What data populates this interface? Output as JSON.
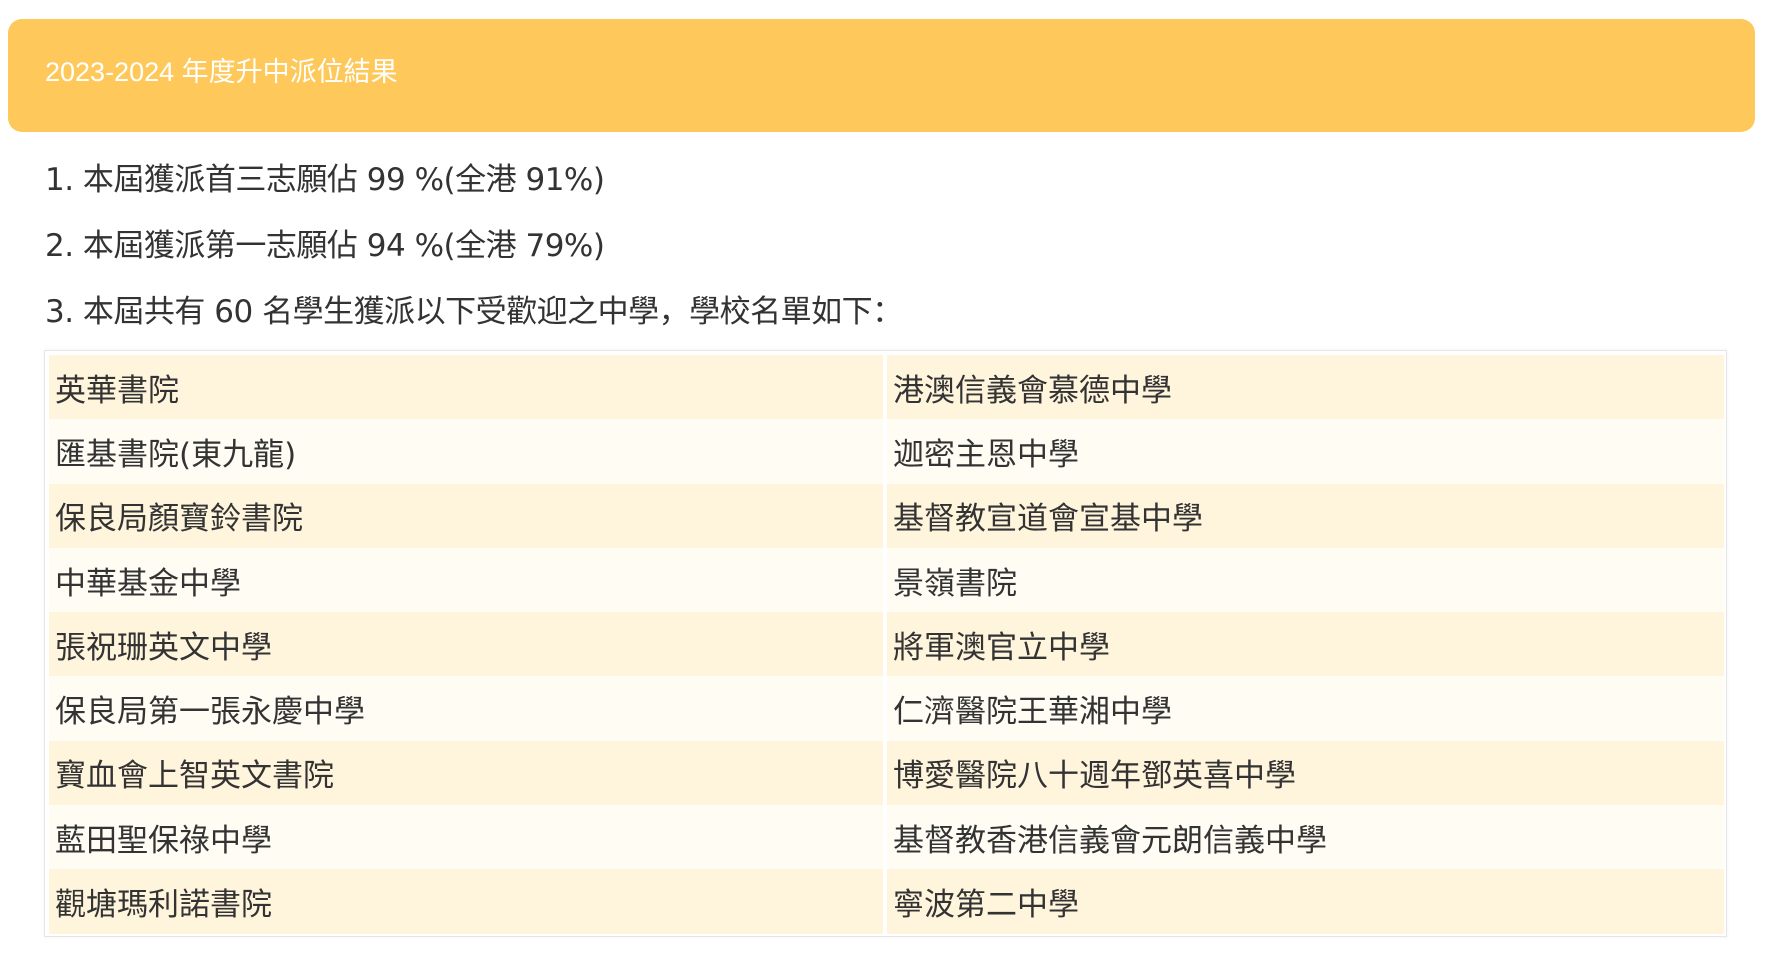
{
  "header": {
    "title": "2023-2024 年度升中派位結果"
  },
  "summary": {
    "items": [
      "1. 本屆獲派首三志願佔 99 %(全港 91%)",
      "2. 本屆獲派第一志願佔 94 %(全港 79%)",
      "3. 本屆共有 60 名學生獲派以下受歡迎之中學，學校名單如下："
    ]
  },
  "schools": {
    "rows": [
      [
        "英華書院",
        "港澳信義會慕德中學"
      ],
      [
        "匯基書院(東九龍)",
        "迦密主恩中學"
      ],
      [
        "保良局顏寶鈴書院",
        "基督教宣道會宣基中學"
      ],
      [
        "中華基金中學",
        "景嶺書院"
      ],
      [
        "張祝珊英文中學",
        "將軍澳官立中學"
      ],
      [
        "保良局第一張永慶中學",
        "仁濟醫院王華湘中學"
      ],
      [
        "寶血會上智英文書院",
        "博愛醫院八十週年鄧英喜中學"
      ],
      [
        "藍田聖保祿中學",
        "基督教香港信義會元朗信義中學"
      ],
      [
        "觀塘瑪利諾書院",
        "寧波第二中學"
      ]
    ]
  },
  "colors": {
    "header_bg": "#fec85a",
    "header_text": "#ffffff",
    "row_odd": "#fff4dc",
    "row_even": "#fffcf4",
    "text": "#333333"
  }
}
